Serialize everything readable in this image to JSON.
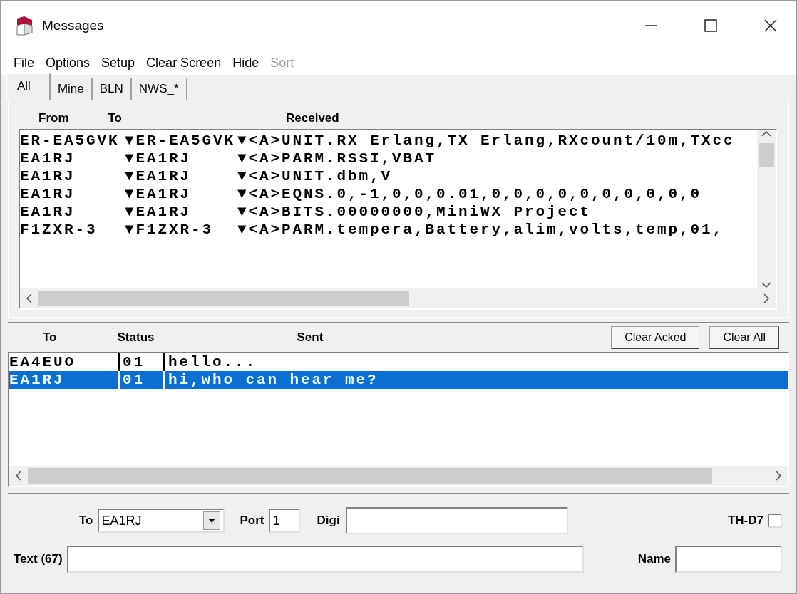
{
  "window": {
    "title": "Messages"
  },
  "menu": [
    {
      "label": "File",
      "disabled": false
    },
    {
      "label": "Options",
      "disabled": false
    },
    {
      "label": "Setup",
      "disabled": false
    },
    {
      "label": "Clear Screen",
      "disabled": false
    },
    {
      "label": "Hide",
      "disabled": false
    },
    {
      "label": "Sort",
      "disabled": true
    }
  ],
  "tabs": [
    {
      "label": "All",
      "selected": true
    },
    {
      "label": "Mine",
      "selected": false
    },
    {
      "label": "BLN",
      "selected": false
    },
    {
      "label": "NWS_*",
      "selected": false
    }
  ],
  "received": {
    "columns": [
      "From",
      "To",
      "Received"
    ],
    "rows": [
      {
        "from": "ER-EA5GVK",
        "to": "▼ER-EA5GVK",
        "message": "▼<A>UNIT.RX Erlang,TX Erlang,RXcount/10m,TXcc"
      },
      {
        "from": "EA1RJ",
        "to": "▼EA1RJ",
        "message": "▼<A>PARM.RSSI,VBAT"
      },
      {
        "from": "EA1RJ",
        "to": "▼EA1RJ",
        "message": "▼<A>UNIT.dbm,V"
      },
      {
        "from": "EA1RJ",
        "to": "▼EA1RJ",
        "message": "▼<A>EQNS.0,-1,0,0,0.01,0,0,0,0,0,0,0,0,0,0"
      },
      {
        "from": "EA1RJ",
        "to": "▼EA1RJ",
        "message": "▼<A>BITS.00000000,MiniWX Project"
      },
      {
        "from": "F1ZXR-3",
        "to": "▼F1ZXR-3",
        "message": "▼<A>PARM.tempera,Battery,alim,volts,temp,01,"
      }
    ]
  },
  "sent": {
    "columns": [
      "To",
      "Status",
      "Sent"
    ],
    "buttons": [
      "Clear Acked",
      "Clear All"
    ],
    "rows": [
      {
        "to": "EA4EUO",
        "status": "01",
        "message": "hello...",
        "selected": false
      },
      {
        "to": "EA1RJ",
        "status": "01",
        "message": "hi,who can hear me?",
        "selected": true
      }
    ]
  },
  "form": {
    "to_label": "To",
    "to_value": "EA1RJ",
    "port_label": "Port",
    "port_value": "1",
    "digi_label": "Digi",
    "thd7_label": "TH-D7",
    "thd7_checked": false,
    "text_label": "Text (67)",
    "name_label": "Name"
  }
}
